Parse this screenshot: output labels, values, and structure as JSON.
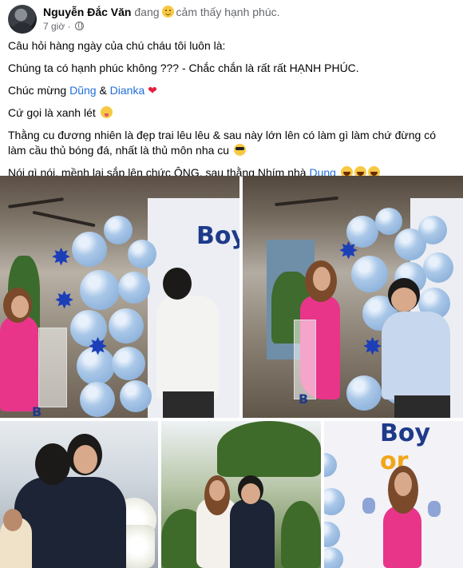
{
  "post": {
    "author": "Nguyễn Đắc Văn",
    "feeling_prefix": "đang",
    "feeling_text": "cảm thấy hạnh phúc.",
    "time": "7 giờ",
    "dot": "·"
  },
  "content": {
    "line1": "Câu hỏi hàng ngày của chú cháu tôi luôn là:",
    "line2": "Chúng ta có hạnh phúc không ??? - Chắc chắn là rất rất HẠNH PHÚC.",
    "line3_prefix": "Chúc mừng",
    "mention1": "Dũng",
    "line3_amp": "&",
    "mention2": "Dianka",
    "line4": "Cứ gọi là xanh lét",
    "line5": "Thằng cu đương nhiên là đẹp trai lêu lêu & sau này lớn lên có làm gì làm chứ đừng có làm cầu thủ bóng đá, nhất là thủ môn nha cu",
    "line6_prefix": "Nói gì nói, mềnh lại sắp lên chức ÔNG, sau thằng Nhím nhà",
    "mention3": "Dụng"
  },
  "photos": {
    "sign_boy": "Boy",
    "sign_boy_or_left": "Boy",
    "sign_boy_or_right": "or",
    "block_letter": "B"
  },
  "icons": {
    "feeling": "smiley-icon",
    "audience": "globe-icon",
    "heart": "heart",
    "heart_glyph": "❤"
  }
}
